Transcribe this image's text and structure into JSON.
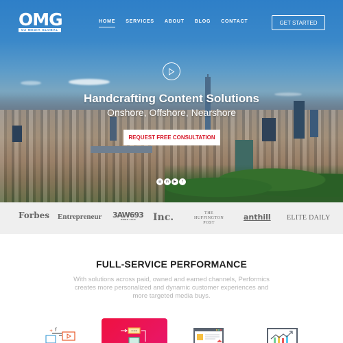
{
  "brand": {
    "logo_text": "OMG",
    "logo_subtitle": "OZ MEDIA GLOBAL"
  },
  "nav": {
    "items": [
      {
        "label": "HOME",
        "active": true
      },
      {
        "label": "SERVICES",
        "active": false
      },
      {
        "label": "ABOUT",
        "active": false
      },
      {
        "label": "BLOG",
        "active": false
      },
      {
        "label": "CONTACT",
        "active": false
      }
    ],
    "cta_label": "GET STARTED"
  },
  "hero": {
    "play_icon": "play-icon",
    "title": "Handcrafting Content Solutions",
    "subtitle": "Onshore, Offshore, Nearshore",
    "cta_label": "REQUEST FREE CONSULTATION",
    "socials": [
      {
        "icon": "instagram-icon",
        "glyph": "◎"
      },
      {
        "icon": "linkedin-icon",
        "glyph": "in"
      },
      {
        "icon": "youtube-icon",
        "glyph": "▶"
      },
      {
        "icon": "facebook-icon",
        "glyph": "f"
      }
    ]
  },
  "press": {
    "logos": [
      "Forbes",
      "Entrepreneur",
      "3AW693",
      "Inc.",
      "THE HUFFINGTON POST",
      "anthill",
      "ELITE DAILY"
    ],
    "three_aw_sub": "NEWS TALK",
    "huff_lines": [
      "THE",
      "HUFFINGTON",
      "POST"
    ]
  },
  "services": {
    "title": "FULL-SERVICE PERFORMANCE",
    "description": "With solutions across paid, owned and earned channels, Performics creates more personalized and dynamic customer experiences and more targeted media buys.",
    "icons": [
      "content-workflow-icon",
      "process-flow-icon",
      "web-page-icon",
      "analytics-chart-icon"
    ]
  },
  "colors": {
    "accent_red": "#d7192a",
    "hero_blue": "#2e7fc8",
    "card_gradient_start": "#ef1140",
    "card_gradient_end": "#e8176a"
  }
}
